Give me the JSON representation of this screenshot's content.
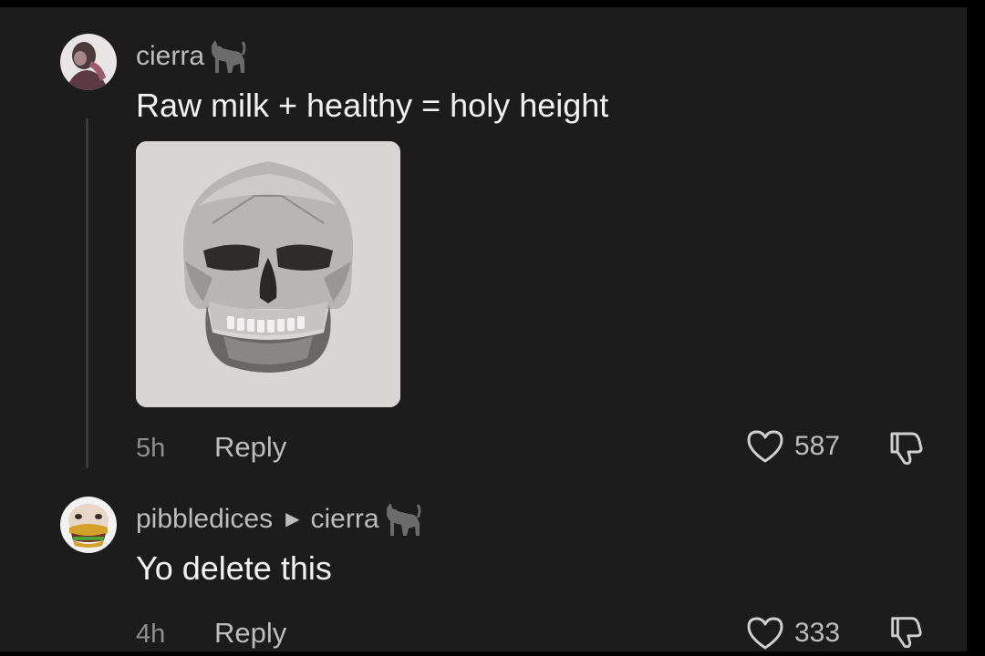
{
  "comments": [
    {
      "username": "cierra",
      "badge_icon": "cat-icon",
      "text": "Raw milk + healthy = holy height",
      "attachment_icon": "skull-image",
      "time": "5h",
      "reply_label": "Reply",
      "likes": "587",
      "like_icon": "heart-outline-icon",
      "dislike_icon": "thumbs-down-icon"
    },
    {
      "username": "pibbledices",
      "reply_to": "cierra",
      "badge_icon": "cat-icon",
      "text": "Yo delete this",
      "time": "4h",
      "reply_label": "Reply",
      "likes": "333",
      "like_icon": "heart-outline-icon",
      "dislike_icon": "thumbs-down-icon"
    }
  ],
  "colors": {
    "background": "#1c1c1c",
    "text_primary": "#f2f2f2",
    "text_secondary": "#bdbdbd",
    "text_muted": "#8f8f8f"
  }
}
